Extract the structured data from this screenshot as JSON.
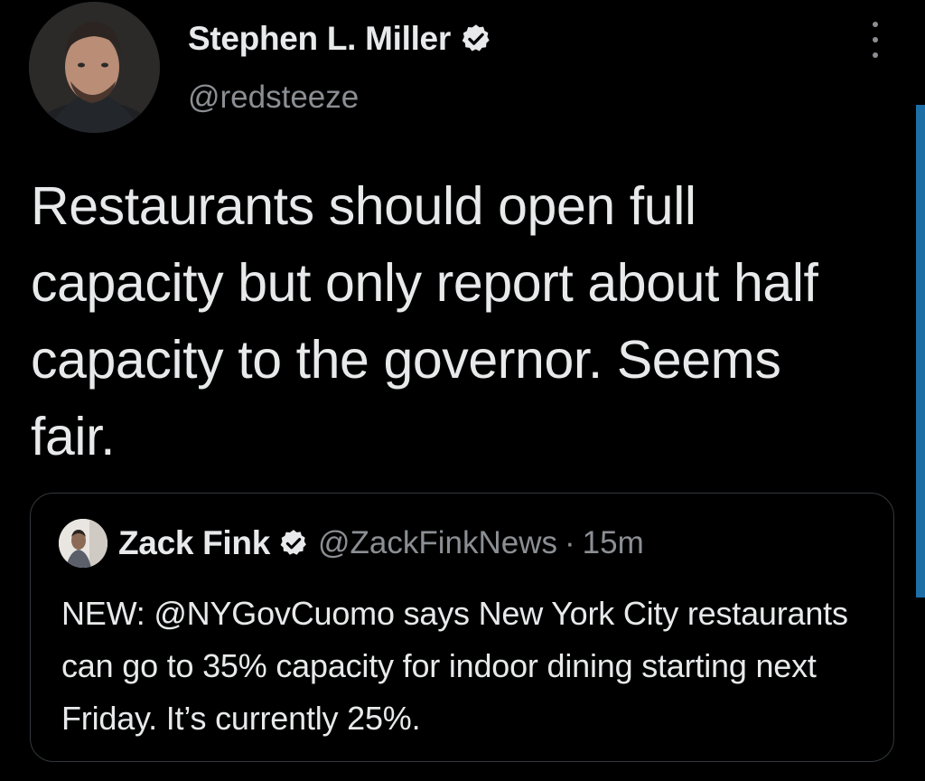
{
  "tweet": {
    "author": {
      "display_name": "Stephen L. Miller",
      "handle": "@redsteeze",
      "verified_icon": "verified-badge-icon"
    },
    "text": "Restaurants should open full capacity but only report about half capacity to the governor. Seems fair.",
    "more_icon": "more-options-icon"
  },
  "quoted_tweet": {
    "author": {
      "display_name": "Zack Fink",
      "handle": "@ZackFinkNews",
      "verified_icon": "verified-badge-icon"
    },
    "separator": "·",
    "time": "15m",
    "text": "NEW: @NYGovCuomo says New York City restaurants can go to 35% capacity for indoor dining starting next Friday. It’s currently 25%."
  },
  "colors": {
    "background": "#000000",
    "primary_text": "#e7e9ea",
    "secondary_text": "#8b8f93",
    "border": "#33383c",
    "scroll_accent": "#1d6fa8"
  }
}
